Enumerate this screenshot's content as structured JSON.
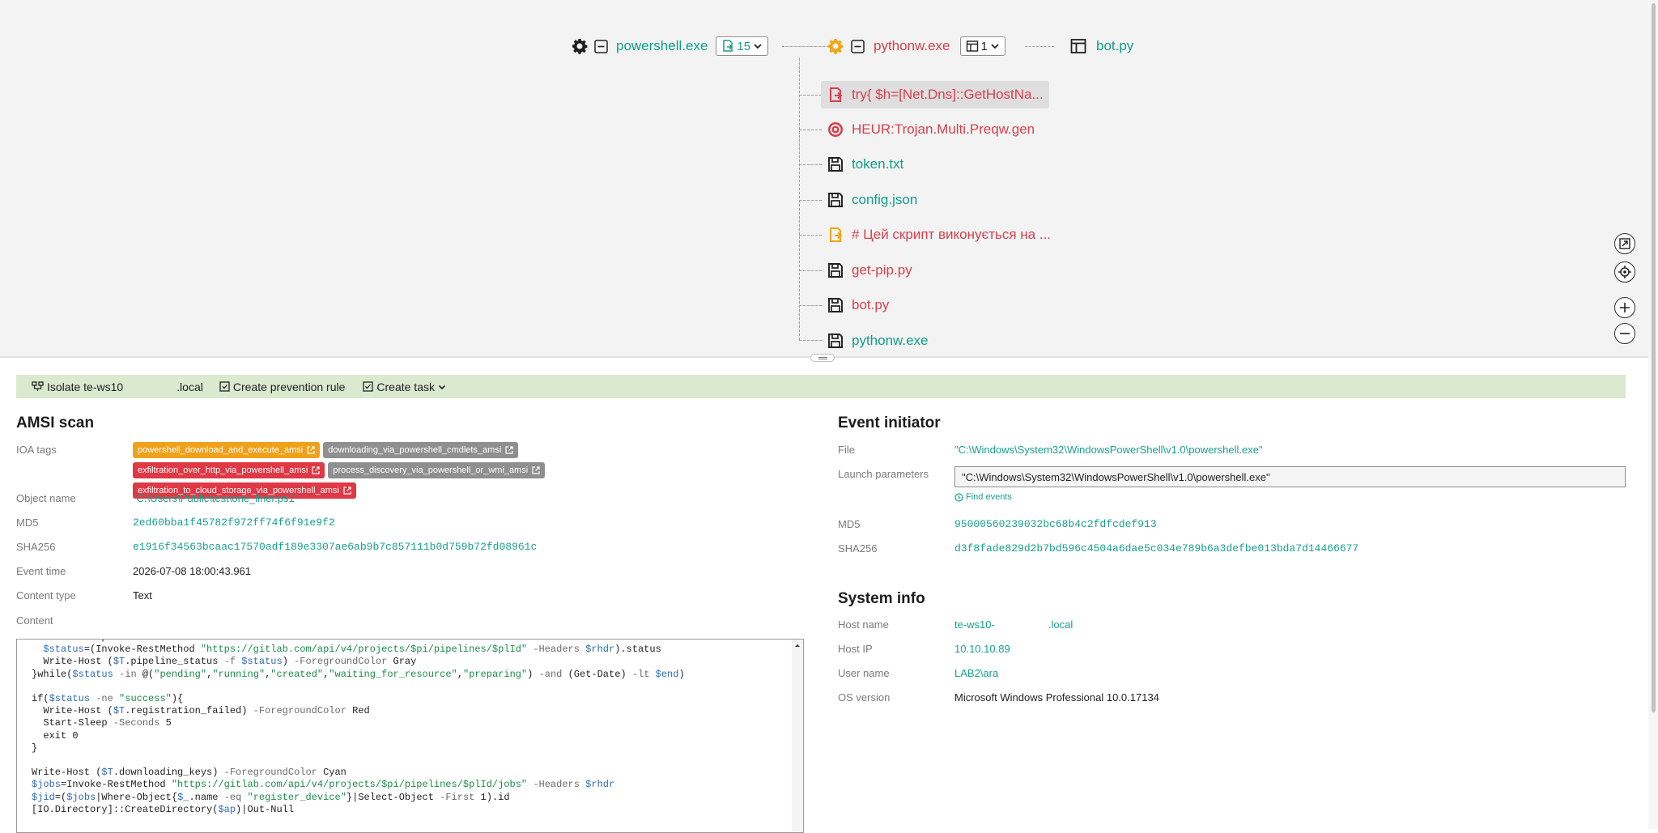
{
  "graph": {
    "root": {
      "label": "powershell.exe",
      "count": "15"
    },
    "parent": {
      "label": "pythonw.exe",
      "count": "1"
    },
    "child_top": {
      "label": "bot.py"
    },
    "children": [
      {
        "label": "try{ $h=[Net.Dns]::GetHostNa...",
        "icon": "script-red-icon"
      },
      {
        "label": "HEUR:Trojan.Multi.Preqw.gen",
        "icon": "detection-icon"
      },
      {
        "label": "token.txt",
        "icon": "file-save-icon"
      },
      {
        "label": "config.json",
        "icon": "file-save-icon"
      },
      {
        "label": "# Цей скрипт виконується на ...",
        "icon": "script-orange-icon"
      },
      {
        "label": "get-pip.py",
        "icon": "file-save-icon"
      },
      {
        "label": "bot.py",
        "icon": "file-save-icon"
      },
      {
        "label": "pythonw.exe",
        "icon": "file-save-icon"
      }
    ]
  },
  "actions": {
    "isolate": "Isolate te-ws10",
    "domain_suffix": ".local",
    "prevention": "Create prevention rule",
    "task": "Create task"
  },
  "amsi": {
    "title": "AMSI scan",
    "ioa_label": "IOA tags",
    "tags": [
      {
        "text": "powershell_download_and_execute_amsi",
        "color": "orange"
      },
      {
        "text": "downloading_via_powershell_cmdlets_amsi",
        "color": "gray"
      },
      {
        "text": "exfiltration_over_http_via_powershell_amsi",
        "color": "red"
      },
      {
        "text": "process_discovery_via_powershell_or_wmi_amsi",
        "color": "gray"
      },
      {
        "text": "exfiltration_to_cloud_storage_via_powershell_amsi",
        "color": "red"
      }
    ],
    "object_name_label": "Object name",
    "object_name": "\"C:\\Users\\Public\\test\\one_liner.ps1\"",
    "md5_label": "MD5",
    "md5": "2ed60bba1f45782f972ff74f6f91e9f2",
    "sha256_label": "SHA256",
    "sha256": "e1916f34563bcaac17570adf189e3307ae6ab9b7c857111b0d759b72fd08961c",
    "event_time_label": "Event time",
    "event_time": "2026-07-08 18:00:43.961",
    "content_type_label": "Content type",
    "content_type": "Text",
    "content_label": "Content"
  },
  "initiator": {
    "title": "Event initiator",
    "file_label": "File",
    "file": "\"C:\\Windows\\System32\\WindowsPowerShell\\v1.0\\powershell.exe\"",
    "launch_label": "Launch parameters",
    "launch": "\"C:\\Windows\\System32\\WindowsPowerShell\\v1.0\\powershell.exe\"",
    "find_events": "Find events",
    "md5_label": "MD5",
    "md5": "95000560239032bc68b4c2fdfcdef913",
    "sha256_label": "SHA256",
    "sha256": "d3f8fade829d2b7bd596c4504a6dae5c034e789b6a3defbe013bda7d14466677"
  },
  "system": {
    "title": "System info",
    "host_label": "Host name",
    "host": "te-ws10-",
    "host_suffix": ".local",
    "ip_label": "Host IP",
    "ip": "10.10.10.89",
    "user_label": "User name",
    "user": "LAB2\\ara",
    "os_label": "OS version",
    "os": "Microsoft Windows Professional 10.0.17134"
  },
  "colors": {
    "teal": "#0e9f8b",
    "red": "#d6404f",
    "orange": "#f2a516",
    "action_bar": "#dbe9cf"
  }
}
